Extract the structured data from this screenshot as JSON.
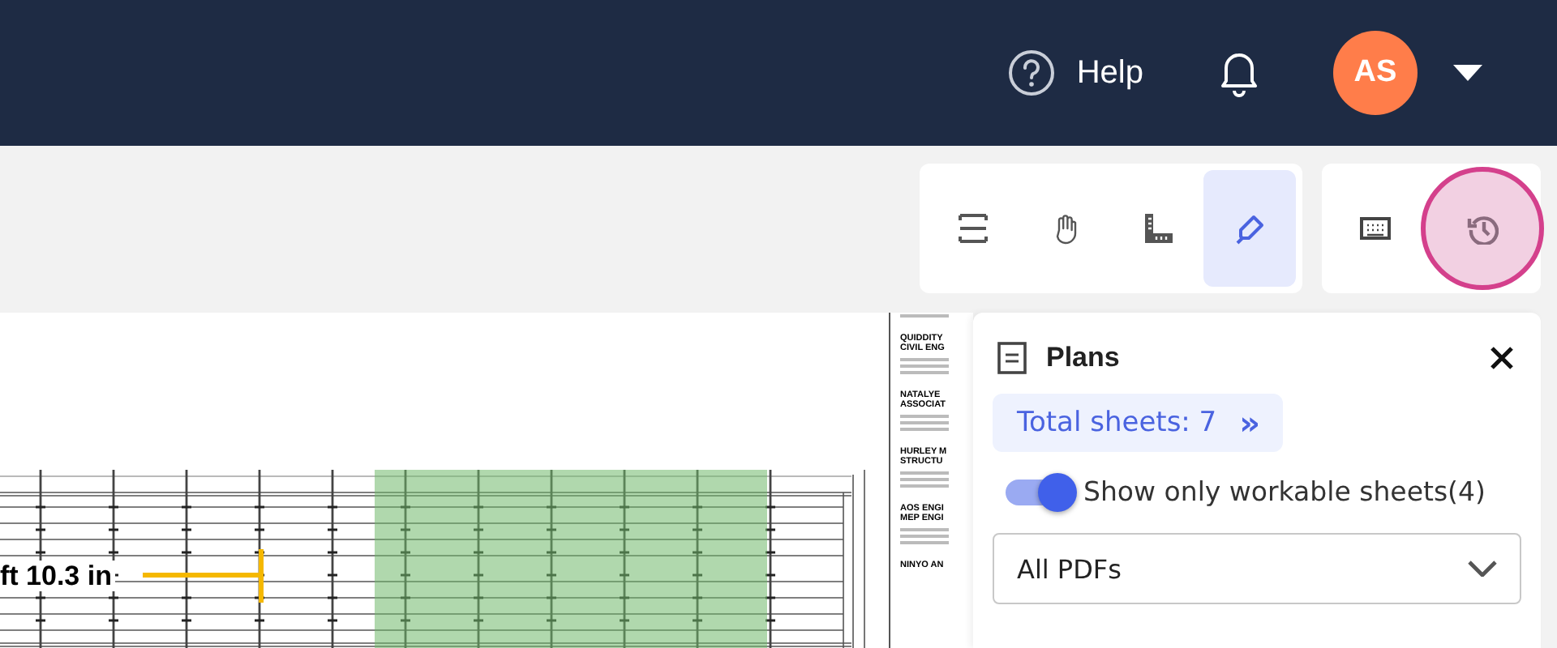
{
  "header": {
    "help_label": "Help",
    "avatar_initials": "AS"
  },
  "tools": [
    {
      "kind": "fit",
      "selected": false
    },
    {
      "kind": "hand",
      "selected": false
    },
    {
      "kind": "ruler",
      "selected": false
    },
    {
      "kind": "marker",
      "selected": true
    }
  ],
  "side_tools": [
    {
      "kind": "keyboard",
      "selected": false
    },
    {
      "kind": "history",
      "selected": true
    }
  ],
  "document": {
    "measurement": "ft 10.3 in",
    "title_block": [
      "QUIDDITY",
      "CIVIL ENG",
      "NATALYE",
      "ASSOCIAT",
      "HURLEY M",
      "STRUCTU",
      "AOS ENGI",
      "MEP ENGI",
      "NINYO AN"
    ]
  },
  "plans_panel": {
    "title": "Plans",
    "total_sheets": "Total sheets: 7",
    "expand_glyph": "»",
    "workable_toggle": {
      "on": true,
      "label": "Show only workable sheets(4)"
    },
    "filter": {
      "value": "All PDFs"
    }
  }
}
